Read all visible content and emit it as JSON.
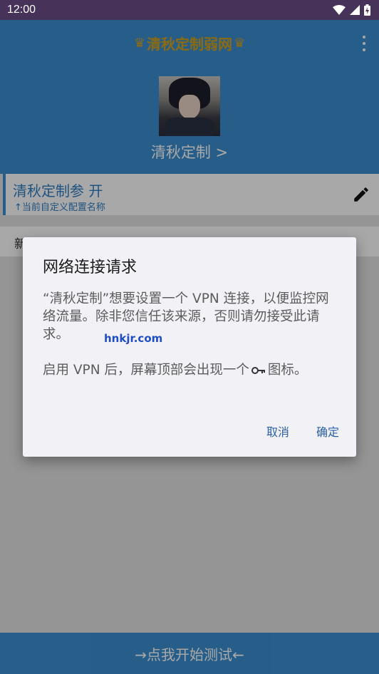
{
  "status_bar": {
    "time": "12:00"
  },
  "app": {
    "title": "清秋定制弱网",
    "crown_left": "♛",
    "crown_right": "♛",
    "profile_name": "清秋定制 >",
    "config_name": "清秋定制参 开",
    "config_hint": "↑当前自定义配置名称",
    "notice": "新增参数配置每次进入需重新添加",
    "start_button": "→点我开始测试←"
  },
  "dialog": {
    "title": "网络连接请求",
    "message_1": "“清秋定制”想要设置一个 VPN 连接，以便监控网络流量。除非您信任该来源，否则请勿接受此请求。",
    "message_2_before": "启用 VPN 后，屏幕顶部会出现一个",
    "message_2_after": "图标。",
    "cancel": "取消",
    "ok": "确定"
  },
  "watermark": "hnkjr.com",
  "icons": {
    "more": "more-vert-icon",
    "edit": "edit-pencil-icon",
    "key": "vpn-key-icon",
    "wifi": "wifi-icon",
    "signal": "signal-icon",
    "battery": "battery-charging-icon"
  },
  "colors": {
    "primary": "#3c8fd1",
    "status_bar": "#47325a",
    "dialog_bg": "#f2f1f6",
    "dialog_button": "#2a5fae",
    "title_gold": "#d4a11f"
  }
}
